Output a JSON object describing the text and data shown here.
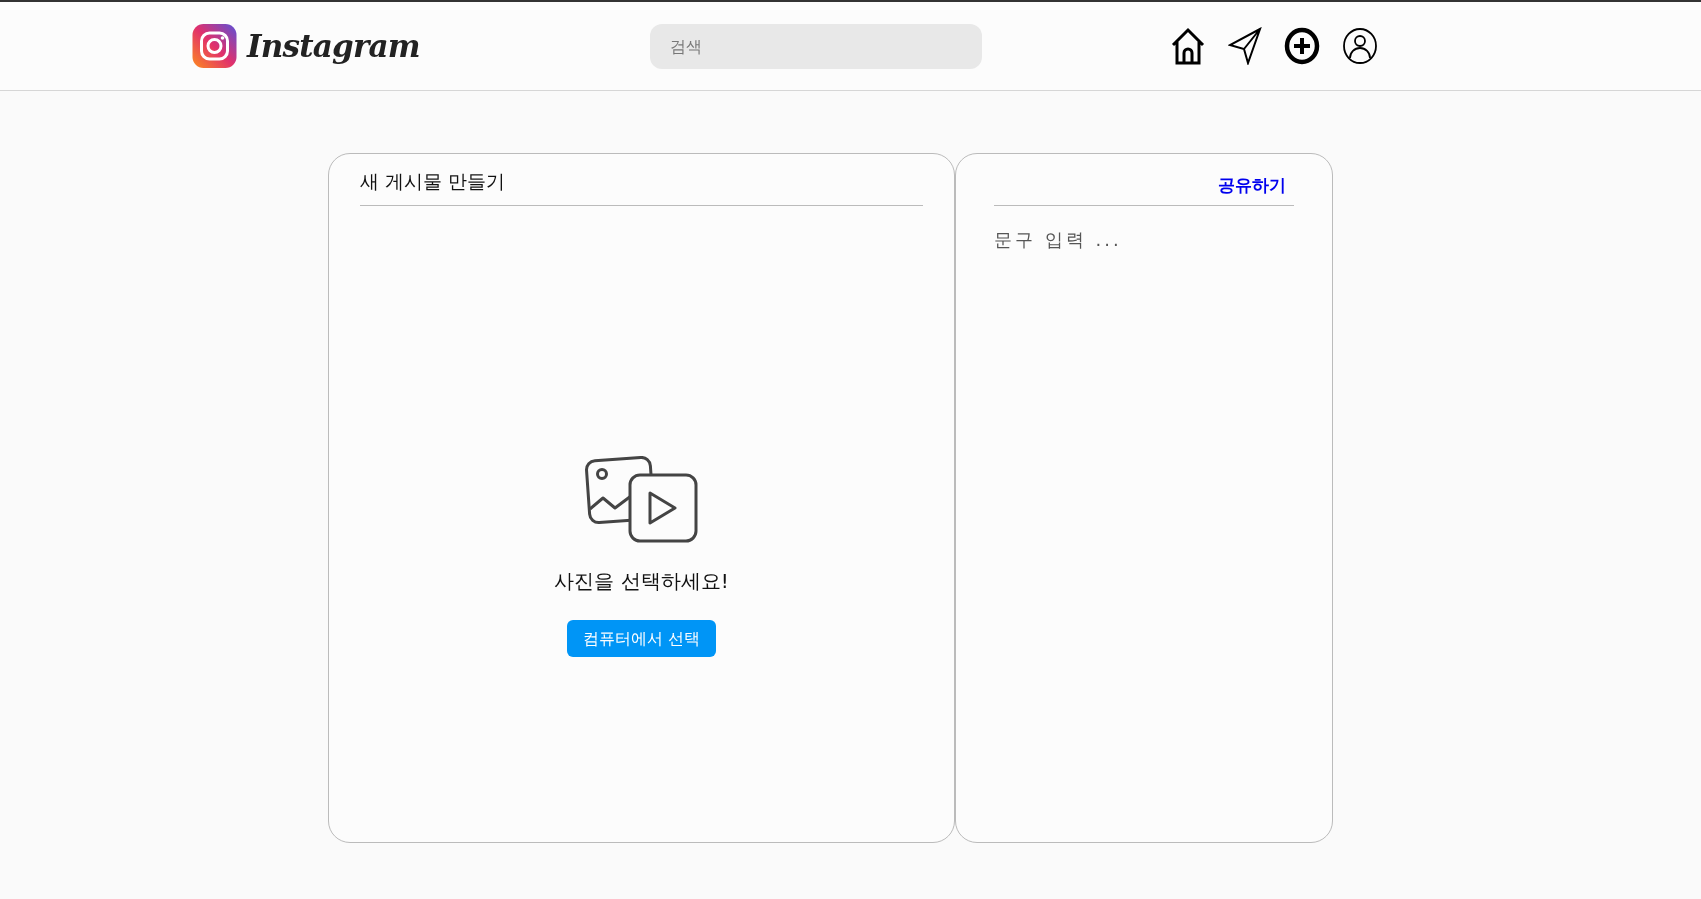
{
  "header": {
    "logo_text": "Instagram",
    "search": {
      "placeholder": "검색"
    }
  },
  "create_panel": {
    "title": "새 게시물 만들기",
    "prompt": "사진을 선택하세요!",
    "button": "컴퓨터에서 선택"
  },
  "caption_panel": {
    "share": "공유하기",
    "caption": {
      "placeholder": "문구 입력 ..."
    }
  }
}
